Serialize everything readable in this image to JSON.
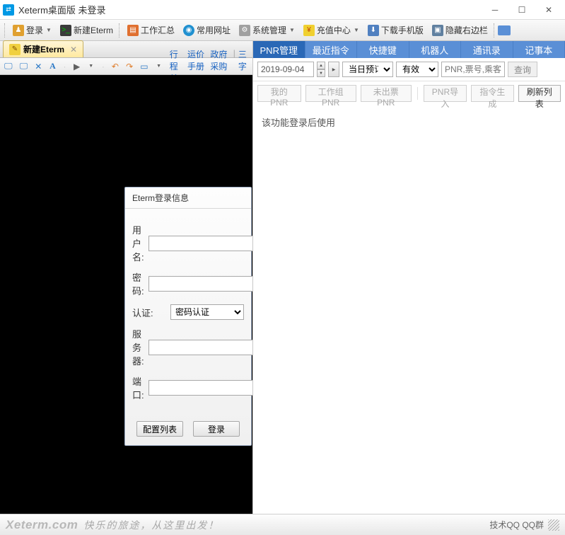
{
  "titlebar": {
    "title": "Xeterm桌面版 未登录"
  },
  "toolbar": {
    "login": "登录",
    "new_eterm": "新建Eterm",
    "work_summary": "工作汇总",
    "common_sites": "常用网址",
    "system_mgmt": "系统管理",
    "recharge": "充值中心",
    "download_mobile": "下载手机版",
    "hide_sidebar": "隐藏右边栏"
  },
  "doc_tab": {
    "label": "新建Eterm"
  },
  "term_links": {
    "itinerary": "行程单",
    "fare_manual": "运价手册",
    "gov_purchase": "政府采购",
    "sep": "|",
    "three_char": "三字"
  },
  "login_dialog": {
    "title": "Eterm登录信息",
    "user": "用户名:",
    "pass": "密码:",
    "auth": "认证:",
    "auth_value": "密码认证",
    "server": "服务器:",
    "port": "端口:",
    "btn_config": "配置列表",
    "btn_login": "登录"
  },
  "side_tabs": [
    "PNR管理",
    "最近指令",
    "快捷键",
    "机器人",
    "通讯录",
    "记事本"
  ],
  "filter": {
    "date": "2019-09-04",
    "today_booking": "当日预订",
    "valid": "有效",
    "search_placeholder": "PNR,票号,乘客",
    "query": "查询"
  },
  "pnr_buttons": {
    "my_pnr": "我的PNR",
    "group_pnr": "工作组PNR",
    "unticketed": "未出票PNR",
    "import": "PNR导入",
    "gen_cmd": "指令生成",
    "refresh": "刷新列表"
  },
  "side_msg": "该功能登录后使用",
  "status": {
    "brand": "Xeterm.com",
    "slogan": "快乐的旅途，从这里出发！",
    "right": "技术QQ  QQ群"
  }
}
